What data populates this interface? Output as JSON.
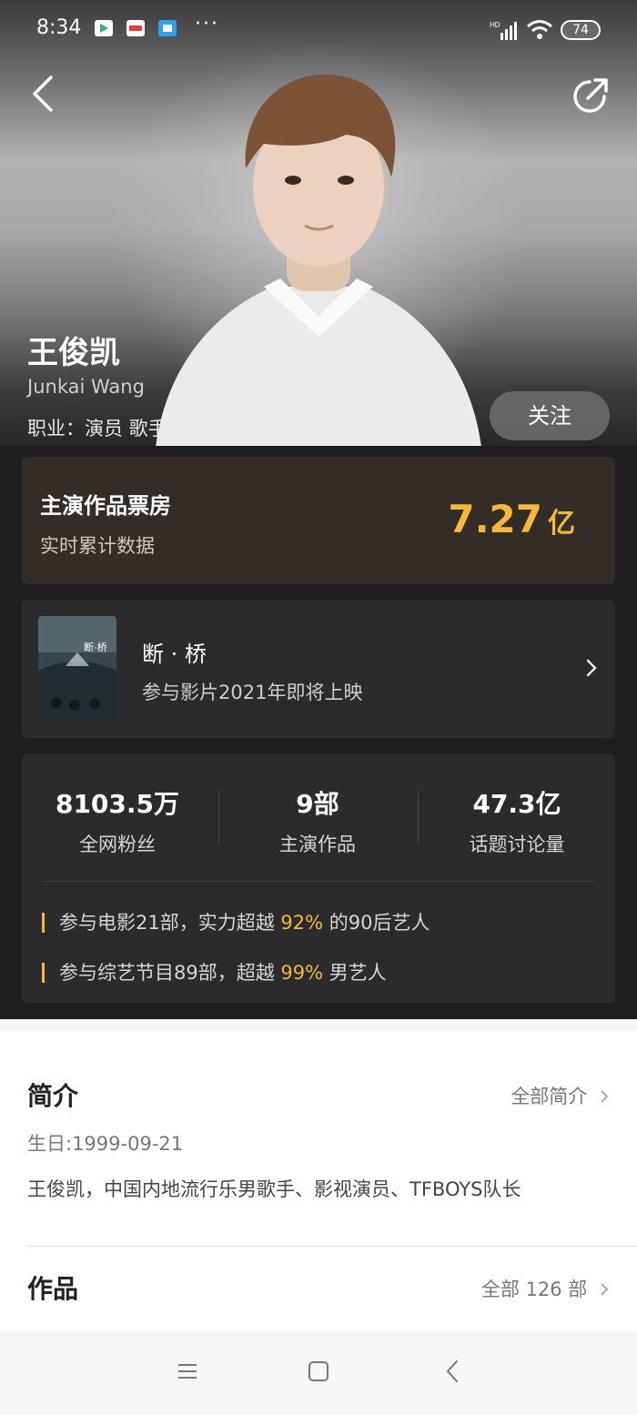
{
  "status_bar": {
    "time": "8:34",
    "battery": "74",
    "notification_icons": [
      "video-app-icon",
      "news-app-icon",
      "store-app-icon"
    ],
    "more": "···"
  },
  "profile": {
    "name": "王俊凯",
    "english_name": "Junkai Wang",
    "occupation": "职业：演员 歌手",
    "follow_label": "关注"
  },
  "box_office": {
    "title": "主演作品票房",
    "subtitle": "实时累计数据",
    "value": "7.27",
    "unit": "亿"
  },
  "upcoming_movie": {
    "title": "断 · 桥",
    "subtitle": "参与影片2021年即将上映"
  },
  "stats": [
    {
      "value": "8103.5万",
      "label": "全网粉丝"
    },
    {
      "value": "9部",
      "label": "主演作品"
    },
    {
      "value": "47.3亿",
      "label": "话题讨论量"
    }
  ],
  "facts": [
    {
      "prefix": "参与电影21部，实力超越 ",
      "highlight": "92%",
      "suffix": " 的90后艺人"
    },
    {
      "prefix": "参与综艺节目89部，超越 ",
      "highlight": "99%",
      "suffix": " 男艺人"
    }
  ],
  "intro": {
    "title": "简介",
    "link": "全部简介",
    "birthday": "生日:1999-09-21",
    "description": "王俊凯，中国内地流行乐男歌手、影视演员、TFBOYS队长"
  },
  "works": {
    "title": "作品",
    "link": "全部 126 部"
  },
  "colors": {
    "accent": "#f6b836",
    "dark_bg": "#1e1e21",
    "card_bg": "#2b2b2e",
    "box_office_bg": "#332c27"
  }
}
